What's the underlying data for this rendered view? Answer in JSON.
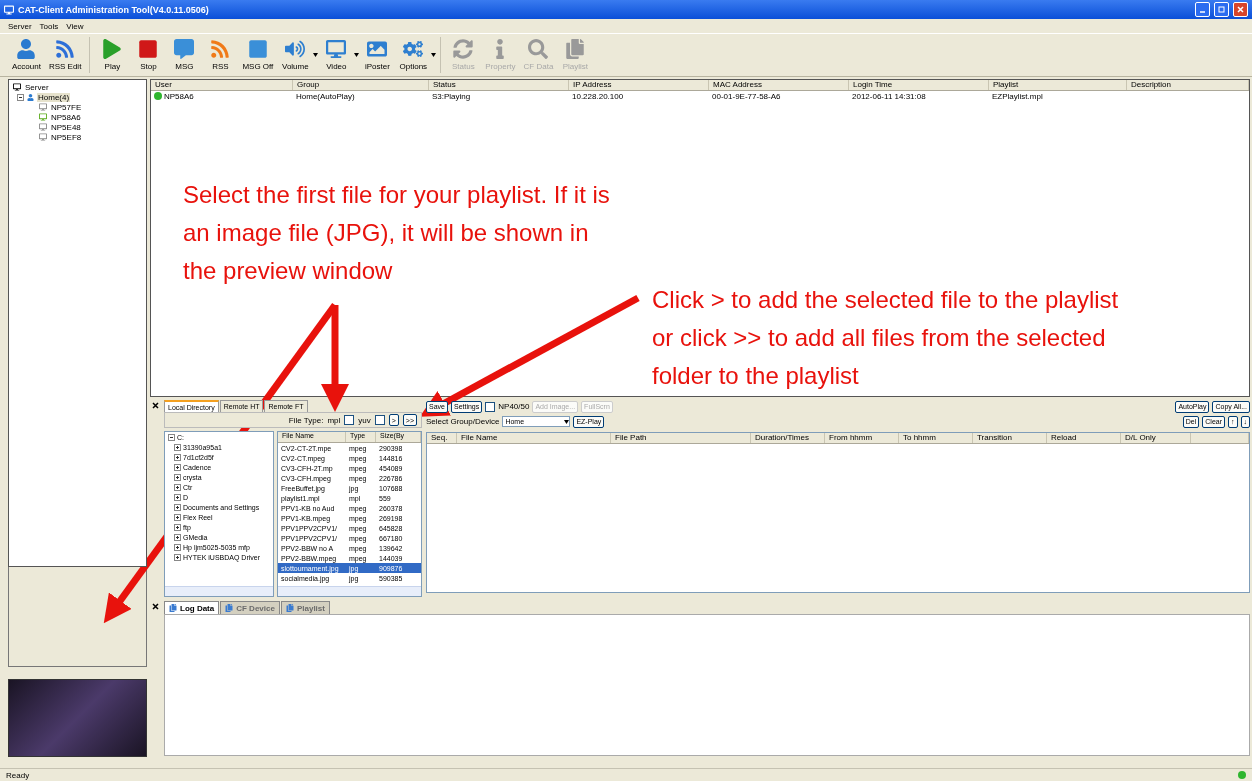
{
  "window": {
    "title": "CAT-Client Administration Tool(V4.0.11.0506)"
  },
  "menu": [
    "Server",
    "Tools",
    "View"
  ],
  "toolbar": [
    {
      "label": "Account",
      "disabled": false,
      "dropdown": false
    },
    {
      "label": "RSS Edit",
      "disabled": false,
      "dropdown": false
    },
    {
      "label": "Play",
      "disabled": false,
      "dropdown": false
    },
    {
      "label": "Stop",
      "disabled": false,
      "dropdown": false
    },
    {
      "label": "MSG",
      "disabled": false,
      "dropdown": false
    },
    {
      "label": "RSS",
      "disabled": false,
      "dropdown": false
    },
    {
      "label": "MSG Off",
      "disabled": false,
      "dropdown": false
    },
    {
      "label": "Volume",
      "disabled": false,
      "dropdown": true
    },
    {
      "label": "Video",
      "disabled": false,
      "dropdown": true
    },
    {
      "label": "iPoster",
      "disabled": false,
      "dropdown": false
    },
    {
      "label": "Options",
      "disabled": false,
      "dropdown": true
    },
    {
      "label": "Status",
      "disabled": true,
      "dropdown": false
    },
    {
      "label": "Property",
      "disabled": true,
      "dropdown": false
    },
    {
      "label": "CF Data",
      "disabled": true,
      "dropdown": false
    },
    {
      "label": "Playlist",
      "disabled": true,
      "dropdown": false
    }
  ],
  "tree": {
    "label": "Server",
    "children": [
      {
        "label": "Home(4)",
        "selected": true,
        "children": [
          {
            "label": "NP57FE",
            "online": false
          },
          {
            "label": "NP58A6",
            "online": true
          },
          {
            "label": "NP5E48",
            "online": false
          },
          {
            "label": "NP5EF8",
            "online": false
          }
        ]
      }
    ]
  },
  "devices": {
    "columns": [
      "User",
      "Group",
      "Status",
      "IP Address",
      "MAC Address",
      "Login Time",
      "Playlist",
      "Description"
    ],
    "rows": [
      {
        "online": true,
        "cells": [
          "NP58A6",
          "Home(AutoPlay)",
          "S3:Playing",
          "10.228.20.100",
          "00-01-9E-77-58-A6",
          "2012-06-11 14:31:08",
          "EZPlaylist.mpl",
          ""
        ]
      }
    ]
  },
  "file_panel": {
    "tabs": [
      {
        "label": "Local Directory",
        "selected": true
      },
      {
        "label": "Remote HT",
        "selected": false
      },
      {
        "label": "Remote FT",
        "selected": false
      }
    ],
    "file_type_label": "File Type:",
    "filters": [
      {
        "label": "mpl",
        "checked": false
      },
      {
        "label": "yuv",
        "checked": false
      }
    ],
    "add_buttons": [
      ">",
      ">>"
    ],
    "folders": [
      "C:",
      "31390a95a1",
      "7d1cf2d5f",
      "Cadence",
      "crysta",
      "Ctr",
      "D",
      "Documents and Settings",
      "Flex Reel",
      "ftp",
      "GMedia",
      "Hp ljm5025-5035 mfp",
      "HYTEK iUSBDAQ Driver"
    ],
    "file_columns": [
      "File Name",
      "Type",
      "Size(By"
    ],
    "files": [
      {
        "cells": [
          "CV2-CT-2T.mpe",
          "mpeg",
          "290398"
        ],
        "selected": false
      },
      {
        "cells": [
          "CV2-CT.mpeg",
          "mpeg",
          "144816"
        ],
        "selected": false
      },
      {
        "cells": [
          "CV3-CFH-2T.mp",
          "mpeg",
          "454089"
        ],
        "selected": false
      },
      {
        "cells": [
          "CV3-CFH.mpeg",
          "mpeg",
          "226786"
        ],
        "selected": false
      },
      {
        "cells": [
          "FreeBuffet.jpg",
          "jpg",
          "107688"
        ],
        "selected": false
      },
      {
        "cells": [
          "playlist1.mpl",
          "mpl",
          "559"
        ],
        "selected": false
      },
      {
        "cells": [
          "PPV1-KB no Aud",
          "mpeg",
          "260378"
        ],
        "selected": false
      },
      {
        "cells": [
          "PPV1-KB.mpeg",
          "mpeg",
          "269198"
        ],
        "selected": false
      },
      {
        "cells": [
          "PPV1PPV2CPV1/",
          "mpeg",
          "645828"
        ],
        "selected": false
      },
      {
        "cells": [
          "PPV1PPV2CPV1/",
          "mpeg",
          "667180"
        ],
        "selected": false
      },
      {
        "cells": [
          "PPV2-BBW no A",
          "mpeg",
          "139642"
        ],
        "selected": false
      },
      {
        "cells": [
          "PPV2-BBW.mpeg",
          "mpeg",
          "144039"
        ],
        "selected": false
      },
      {
        "cells": [
          "slottournament.jpg",
          "jpg",
          "909876"
        ],
        "selected": true
      },
      {
        "cells": [
          "socialmedia.jpg",
          "jpg",
          "590385"
        ],
        "selected": false
      }
    ]
  },
  "playlist": {
    "buttons": [
      {
        "label": "Save",
        "disabled": false
      },
      {
        "label": "Settings",
        "disabled": false
      },
      {
        "label": "NP40/50",
        "kind": "checkbox",
        "checked": false
      },
      {
        "label": "Add Image...",
        "disabled": true
      },
      {
        "label": "FullScrn",
        "disabled": true
      }
    ],
    "right_buttons": [
      "AutoPlay",
      "Copy All..."
    ],
    "edit_buttons": [
      "Del",
      "Clear",
      "↑",
      "↓"
    ],
    "group_label": "Select Group/Device",
    "group_value": "Home",
    "ez_button": "EZ-Play",
    "columns": [
      "Seq.",
      "File Name",
      "File Path",
      "Duration/Times",
      "From hhmm",
      "To hhmm",
      "Transition",
      "Reload",
      "D/L Only"
    ]
  },
  "log_tabs": [
    {
      "label": "Log Data",
      "selected": true
    },
    {
      "label": "CF Device",
      "selected": false
    },
    {
      "label": "Playlist",
      "selected": false
    }
  ],
  "status_bar": "Ready",
  "annotations": [
    {
      "text": "Select the first file for your playlist.  If it is an image file (JPG), it will be shown in the preview window"
    },
    {
      "text": "Click > to add the selected file to the playlist or click >> to add all files from the selected folder to the playlist"
    }
  ]
}
